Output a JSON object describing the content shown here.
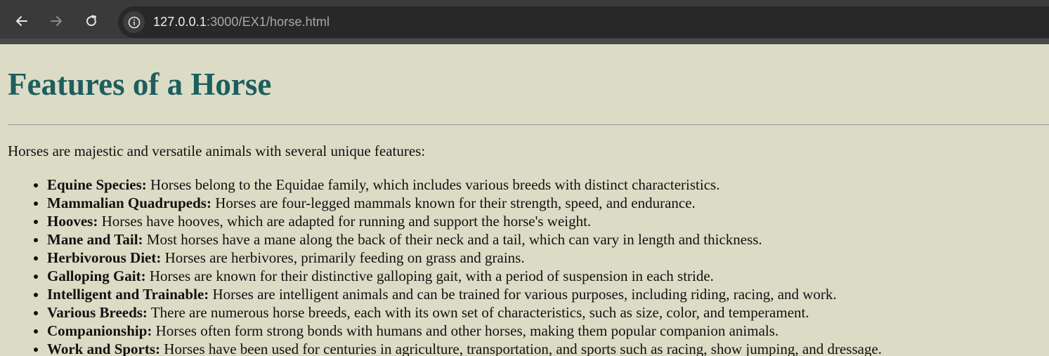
{
  "browser": {
    "url_host": "127.0.0.1",
    "url_rest": ":3000/EX1/horse.html"
  },
  "page": {
    "title": "Features of a Horse",
    "intro": "Horses are majestic and versatile animals with several unique features:",
    "features": [
      {
        "term": "Equine Species:",
        "text": " Horses belong to the Equidae family, which includes various breeds with distinct characteristics."
      },
      {
        "term": "Mammalian Quadrupeds:",
        "text": " Horses are four-legged mammals known for their strength, speed, and endurance."
      },
      {
        "term": "Hooves:",
        "text": " Horses have hooves, which are adapted for running and support the horse's weight."
      },
      {
        "term": "Mane and Tail:",
        "text": " Most horses have a mane along the back of their neck and a tail, which can vary in length and thickness."
      },
      {
        "term": "Herbivorous Diet:",
        "text": " Horses are herbivores, primarily feeding on grass and grains."
      },
      {
        "term": "Galloping Gait:",
        "text": " Horses are known for their distinctive galloping gait, with a period of suspension in each stride."
      },
      {
        "term": "Intelligent and Trainable:",
        "text": " Horses are intelligent animals and can be trained for various purposes, including riding, racing, and work."
      },
      {
        "term": "Various Breeds:",
        "text": " There are numerous horse breeds, each with its own set of characteristics, such as size, color, and temperament."
      },
      {
        "term": "Companionship:",
        "text": " Horses often form strong bonds with humans and other horses, making them popular companion animals."
      },
      {
        "term": "Work and Sports:",
        "text": " Horses have been used for centuries in agriculture, transportation, and sports such as racing, show jumping, and dressage."
      }
    ]
  },
  "colors": {
    "background": "#dcdcc6",
    "heading": "#1d5e5e",
    "toolbar": "#3a3a3a"
  },
  "icons": {
    "back": "arrow-left-icon",
    "forward": "arrow-right-icon",
    "reload": "reload-icon",
    "info": "info-icon"
  }
}
